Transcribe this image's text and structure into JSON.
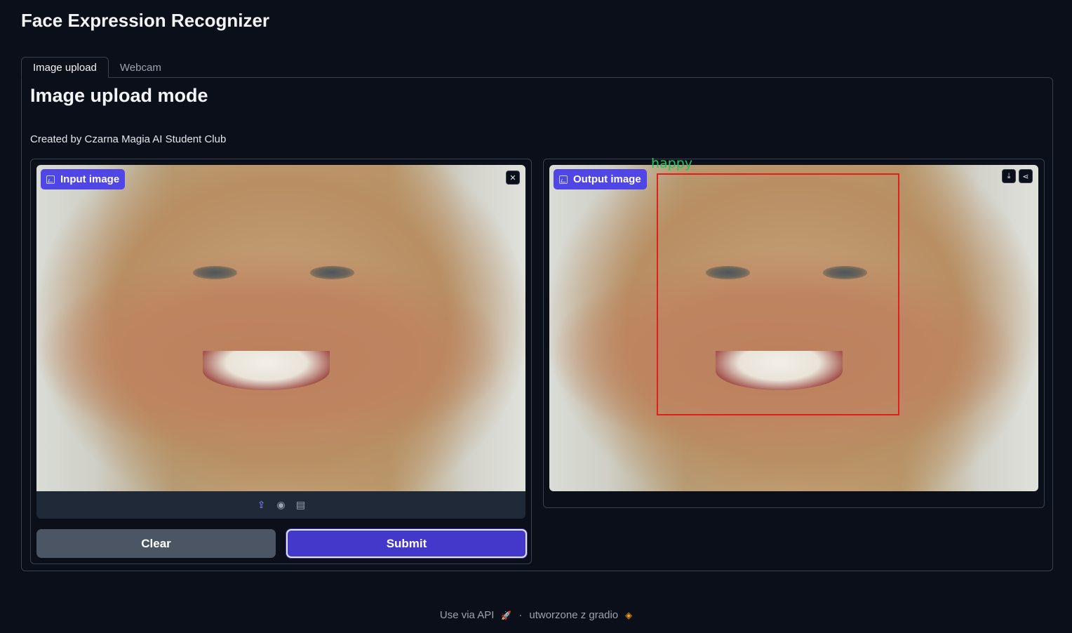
{
  "app": {
    "title": "Face Expression Recognizer"
  },
  "tabs": [
    {
      "label": "Image upload",
      "active": true
    },
    {
      "label": "Webcam",
      "active": false
    }
  ],
  "main": {
    "heading": "Image upload mode",
    "credit": "Created by Czarna Magia AI Student Club"
  },
  "input_panel": {
    "label": "Input image",
    "icons": [
      "image-icon",
      "close-icon",
      "upload-icon",
      "webcam-icon",
      "clipboard-icon"
    ],
    "clear_label": "Clear",
    "submit_label": "Submit"
  },
  "output_panel": {
    "label": "Output image",
    "detection_label": "happy",
    "icons": [
      "image-icon",
      "download-icon",
      "share-icon"
    ]
  },
  "footer": {
    "api_text": "Use via API",
    "separator": "·",
    "built_with": "utworzone z gradio"
  },
  "colors": {
    "background": "#0b0f19",
    "accent": "#4f46e5",
    "submit": "#4338ca",
    "clear": "#4b5563",
    "box": "#e11d1d",
    "detection_text": "#22c55e"
  }
}
